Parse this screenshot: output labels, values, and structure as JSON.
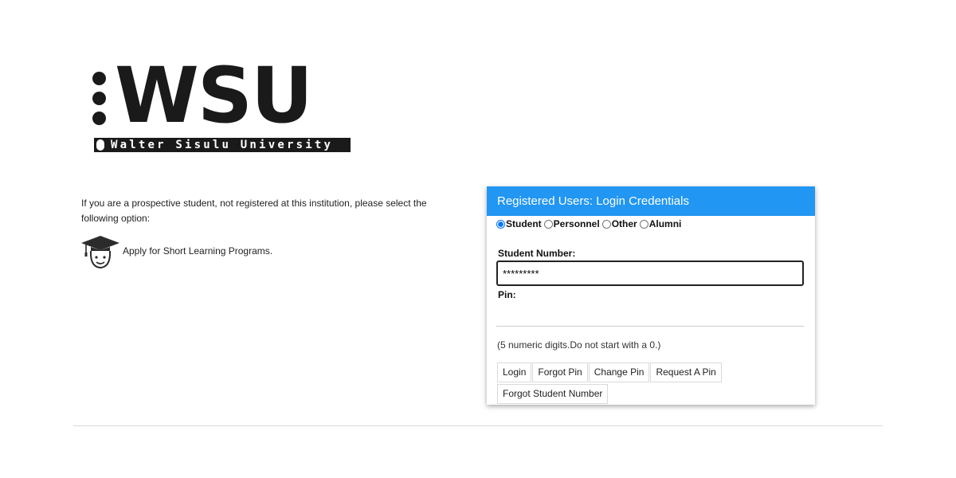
{
  "logo": {
    "mark": "WSU",
    "name": "Walter Sisulu University"
  },
  "prospective": {
    "text": "If you are a prospective student, not registered at this institution, please select the following option:",
    "link_label": "Apply for Short Learning Programs.",
    "icon": "graduation-cap-student-icon"
  },
  "login": {
    "header": "Registered Users: Login Credentials",
    "header_color": "#2196f3",
    "roles": [
      {
        "label": "Student",
        "selected": true
      },
      {
        "label": "Personnel",
        "selected": false
      },
      {
        "label": "Other",
        "selected": false
      },
      {
        "label": "Alumni",
        "selected": false
      }
    ],
    "student_number_label": "Student Number:",
    "student_number_value": "*********",
    "pin_label": "Pin:",
    "pin_value": "",
    "hint": "(5 numeric digits.Do not start with a 0.)",
    "buttons": {
      "login": "Login",
      "forgot_pin": "Forgot Pin",
      "change_pin": "Change Pin",
      "request_pin": "Request A Pin",
      "forgot_student_number": "Forgot Student Number"
    }
  }
}
